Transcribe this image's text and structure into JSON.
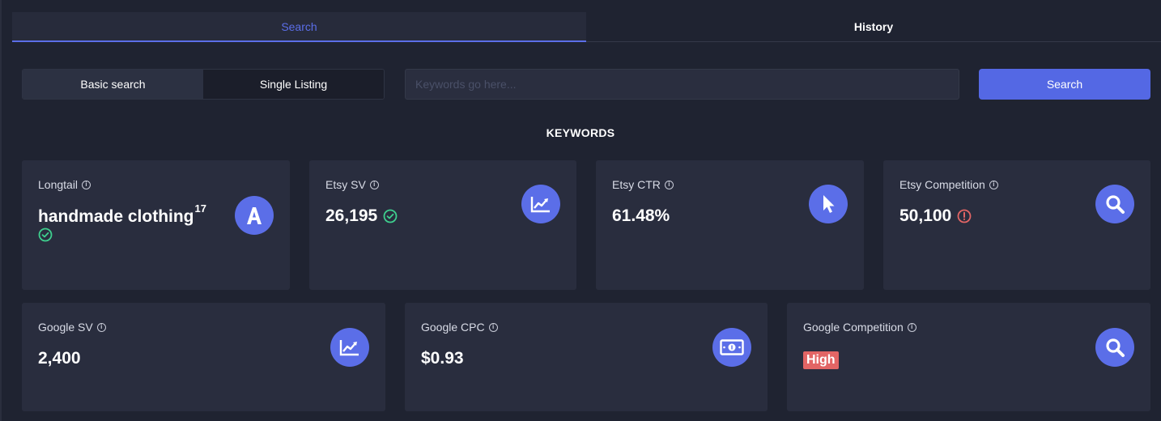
{
  "tabs": [
    {
      "label": "Search",
      "active": true
    },
    {
      "label": "History",
      "active": false
    }
  ],
  "mode": {
    "basic_label": "Basic search",
    "single_label": "Single Listing",
    "selected": "Basic search"
  },
  "search": {
    "placeholder": "Keywords go here...",
    "value": "",
    "button_label": "Search"
  },
  "section_title": "KEYWORDS",
  "cards": {
    "longtail": {
      "label": "Longtail",
      "value": "handmade clothing",
      "superscript": "17",
      "status_icon": "check-circle-icon",
      "icon": "letter-a-icon"
    },
    "etsy_sv": {
      "label": "Etsy SV",
      "value": "26,195",
      "status_icon": "check-circle-icon",
      "icon": "trend-chart-icon"
    },
    "etsy_ctr": {
      "label": "Etsy CTR",
      "value": "61.48%",
      "icon": "pointer-icon"
    },
    "etsy_competition": {
      "label": "Etsy Competition",
      "value": "50,100",
      "status_icon": "alert-circle-icon",
      "icon": "magnifier-icon"
    },
    "google_sv": {
      "label": "Google SV",
      "value": "2,400",
      "icon": "trend-chart-icon"
    },
    "google_cpc": {
      "label": "Google CPC",
      "value": "$0.93",
      "icon": "banknote-icon"
    },
    "google_competition": {
      "label": "Google Competition",
      "badge": "High",
      "icon": "magnifier-icon"
    }
  },
  "colors": {
    "background": "#1f2331",
    "card": "#292d3e",
    "accent": "#5b6ee8",
    "success": "#3ecf8e",
    "danger": "#e26565"
  }
}
